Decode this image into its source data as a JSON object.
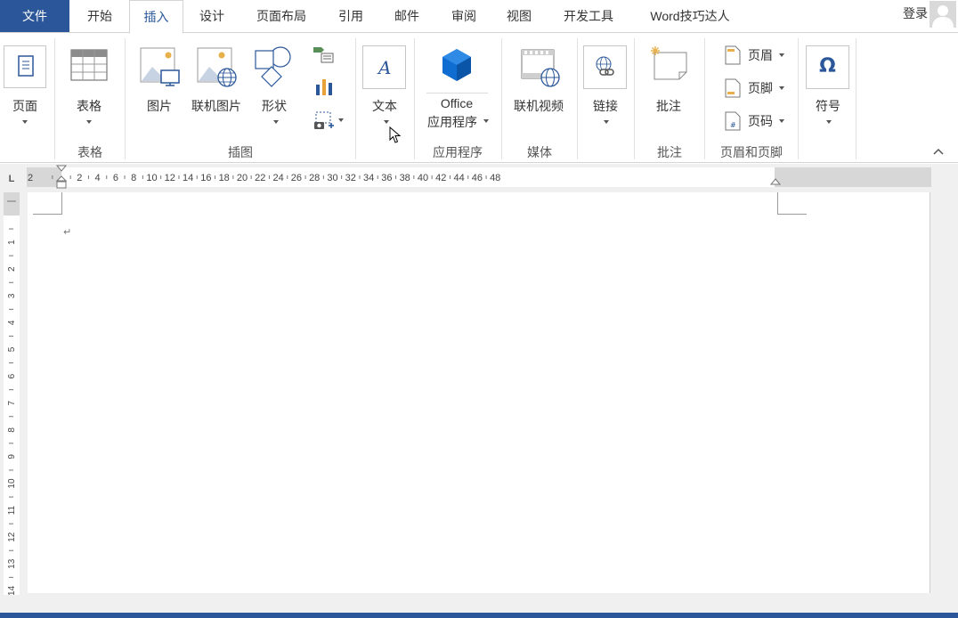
{
  "tabs": {
    "file": "文件",
    "home": "开始",
    "insert": "插入",
    "design": "设计",
    "layout": "页面布局",
    "references": "引用",
    "mailings": "邮件",
    "review": "审阅",
    "view": "视图",
    "developer": "开发工具",
    "expert": "Word技巧达人",
    "active": "插入"
  },
  "account": {
    "login_label": "登录",
    "avatar_icon": "user-avatar-icon"
  },
  "ribbon": {
    "pages": {
      "label": "页面"
    },
    "table": {
      "label": "表格",
      "group": "表格"
    },
    "illustrations": {
      "group": "插图",
      "picture": "图片",
      "online_picture": "联机图片",
      "shapes": "形状"
    },
    "text": {
      "label": "文本"
    },
    "apps": {
      "label_line1": "Office",
      "label_line2": "应用程序",
      "group": "应用程序"
    },
    "media": {
      "label": "联机视频",
      "group": "媒体"
    },
    "links": {
      "label": "链接"
    },
    "comments": {
      "label": "批注",
      "group": "批注"
    },
    "header_footer": {
      "header": "页眉",
      "footer": "页脚",
      "page_number": "页码",
      "group": "页眉和页脚"
    },
    "symbols": {
      "label": "符号",
      "glyph": "Ω"
    }
  },
  "ruler": {
    "corner": "L",
    "left_labels": [
      "2"
    ],
    "labels": [
      "2",
      "4",
      "6",
      "8",
      "10",
      "12",
      "14",
      "16",
      "18",
      "20",
      "22",
      "24",
      "26",
      "28",
      "30",
      "32",
      "34",
      "36",
      "38",
      "40",
      "42",
      "44",
      "46",
      "48"
    ],
    "vertical_labels": [
      "1",
      "2",
      "3",
      "4",
      "5",
      "6",
      "7",
      "8",
      "9",
      "10",
      "11",
      "12",
      "13",
      "14"
    ]
  },
  "document": {
    "paragraph_mark": "↵"
  },
  "colors": {
    "accent": "#2b579a",
    "ribbon_bg": "#ffffff",
    "workspace": "#f0f0f0"
  }
}
